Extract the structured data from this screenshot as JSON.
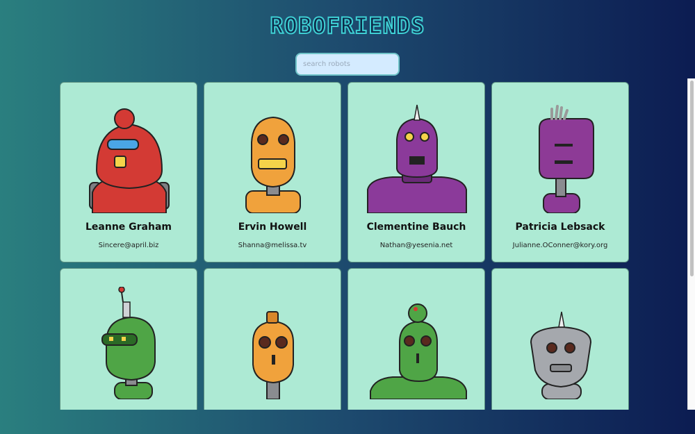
{
  "app": {
    "title": "ROBOFRIENDS"
  },
  "search": {
    "placeholder": "search robots"
  },
  "robots": [
    {
      "name": "Leanne Graham",
      "email": "Sincere@april.biz",
      "color": "#d33a34"
    },
    {
      "name": "Ervin Howell",
      "email": "Shanna@melissa.tv",
      "color": "#f0a23c"
    },
    {
      "name": "Clementine Bauch",
      "email": "Nathan@yesenia.net",
      "color": "#8b3a9a"
    },
    {
      "name": "Patricia Lebsack",
      "email": "Julianne.OConner@kory.org",
      "color": "#8d3a96"
    },
    {
      "name": "",
      "email": "",
      "color": "#4fa546"
    },
    {
      "name": "",
      "email": "",
      "color": "#f0a23c"
    },
    {
      "name": "",
      "email": "",
      "color": "#4fa546"
    },
    {
      "name": "",
      "email": "",
      "color": "#a5a8ad"
    }
  ]
}
